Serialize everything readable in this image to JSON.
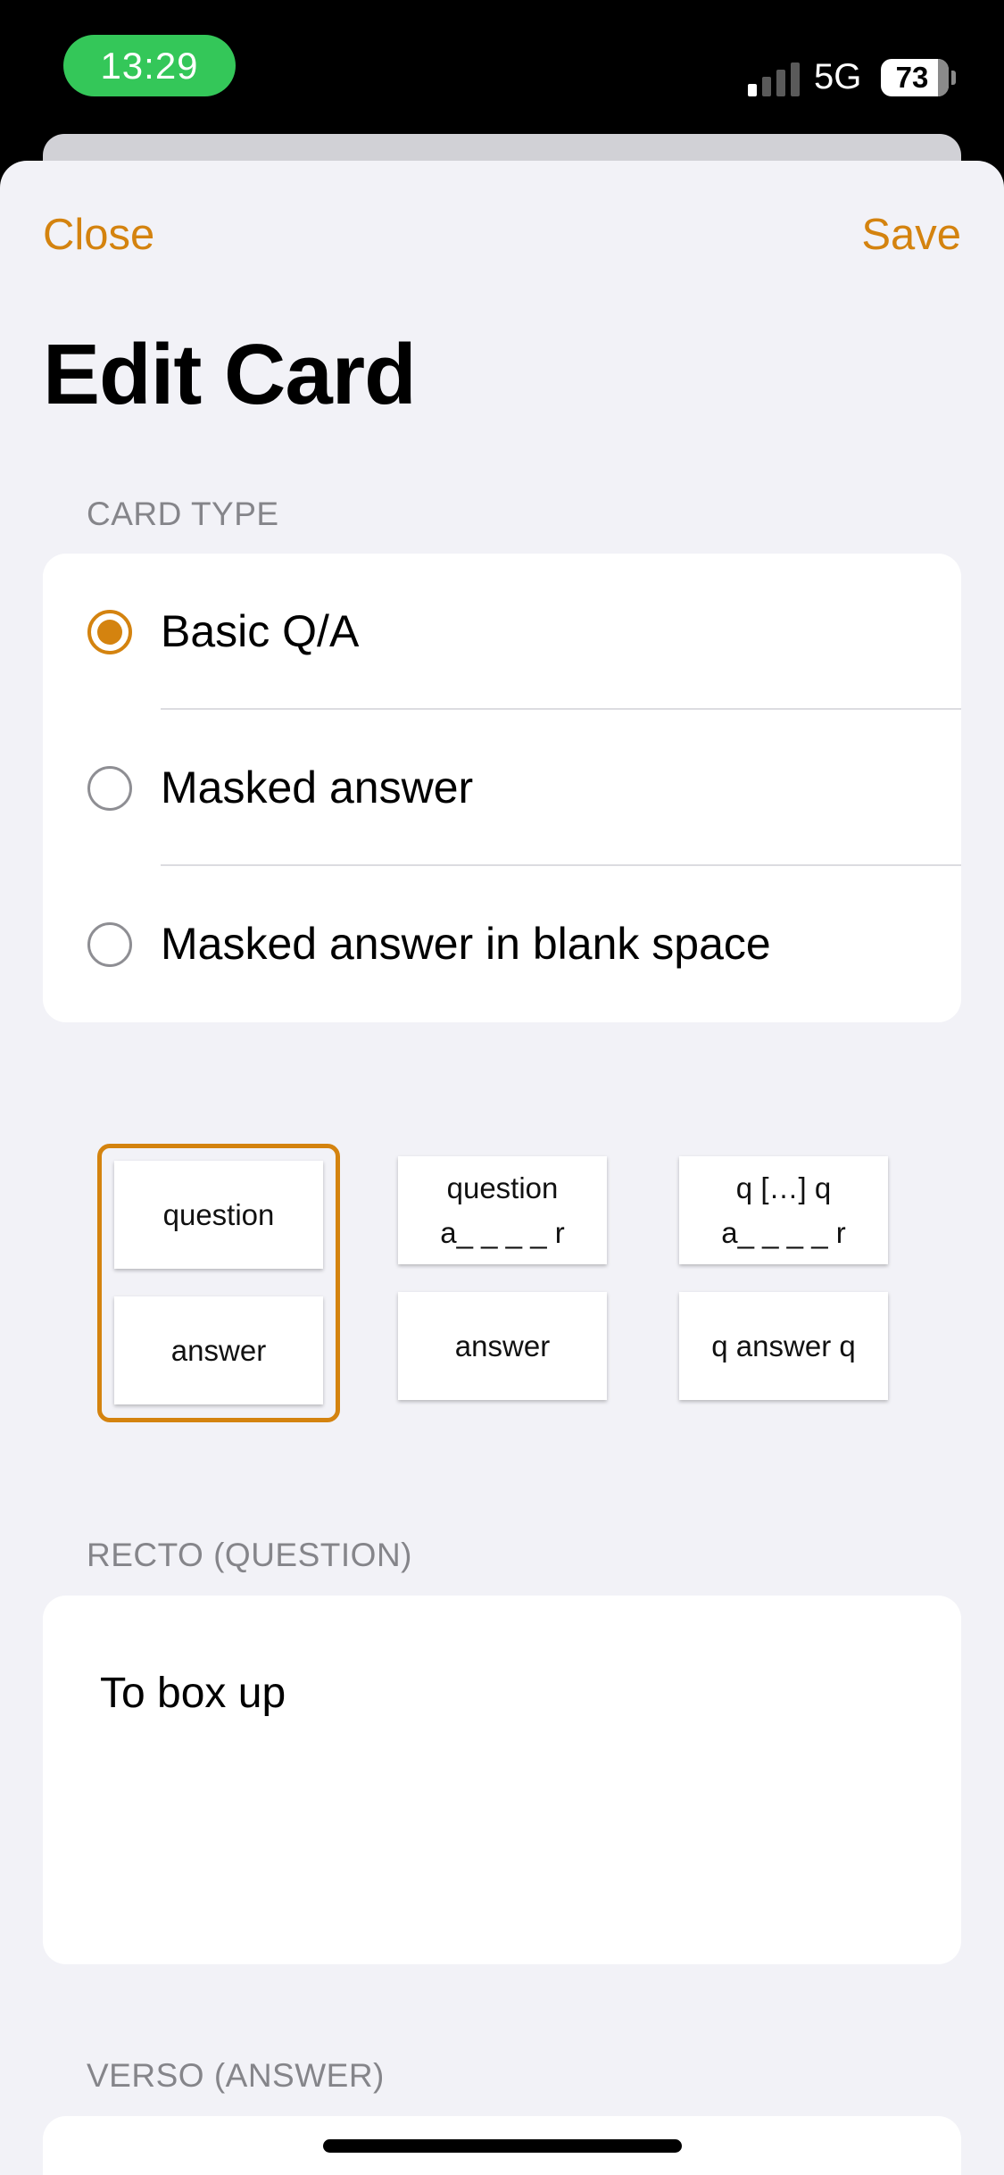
{
  "status_bar": {
    "time": "13:29",
    "network": "5G",
    "battery": "73"
  },
  "nav": {
    "close_label": "Close",
    "save_label": "Save",
    "title": "Edit Card"
  },
  "card_type": {
    "header": "CARD TYPE",
    "options": [
      {
        "label": "Basic Q/A",
        "selected": true
      },
      {
        "label": "Masked answer",
        "selected": false
      },
      {
        "label": "Masked answer in blank space",
        "selected": false
      }
    ]
  },
  "templates": [
    {
      "front_line1": "question",
      "front_line2": "",
      "back": "answer",
      "selected": true
    },
    {
      "front_line1": "question",
      "front_line2": "a_ _ _ _ r",
      "back": "answer",
      "selected": false
    },
    {
      "front_line1": "q […] q",
      "front_line2": "a_ _ _ _ r",
      "back": "q answer q",
      "selected": false
    }
  ],
  "recto": {
    "header": "RECTO (QUESTION)",
    "value": "To box up"
  },
  "verso": {
    "header": "VERSO (ANSWER)",
    "value": ""
  },
  "colors": {
    "accent": "#d4830f",
    "status_green": "#34c759",
    "background": "#f2f2f7"
  }
}
